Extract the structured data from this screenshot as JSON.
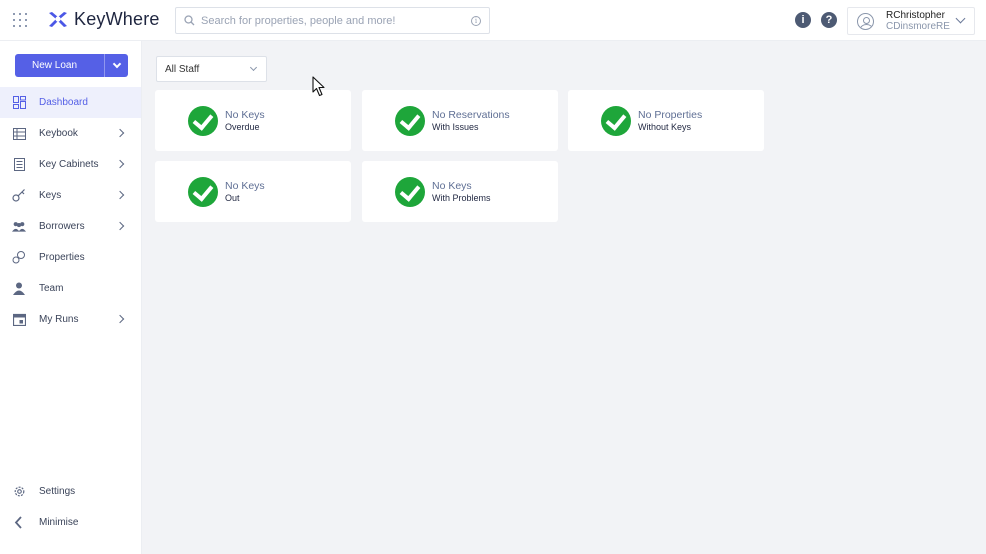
{
  "app": {
    "name": "KeyWhere",
    "brand_color": "#5560e6"
  },
  "header": {
    "search": {
      "placeholder": "Search for properties, people and more!"
    },
    "icons": [
      "apps-grid-icon",
      "info-icon",
      "help-icon"
    ],
    "user": {
      "name": "RChristopher",
      "org": "CDinsmoreRE"
    }
  },
  "sidebar": {
    "new_loan_label": "New Loan",
    "items": [
      {
        "label": "Dashboard",
        "icon": "dashboard-icon",
        "active": true,
        "has_children": false
      },
      {
        "label": "Keybook",
        "icon": "keybook-icon",
        "active": false,
        "has_children": true
      },
      {
        "label": "Key Cabinets",
        "icon": "cabinet-icon",
        "active": false,
        "has_children": true
      },
      {
        "label": "Keys",
        "icon": "key-icon",
        "active": false,
        "has_children": true
      },
      {
        "label": "Borrowers",
        "icon": "people-icon",
        "active": false,
        "has_children": true
      },
      {
        "label": "Properties",
        "icon": "properties-icon",
        "active": false,
        "has_children": false
      },
      {
        "label": "Team",
        "icon": "person-icon",
        "active": false,
        "has_children": false
      },
      {
        "label": "My Runs",
        "icon": "calendar-icon",
        "active": false,
        "has_children": true
      }
    ],
    "bottom": [
      {
        "label": "Settings",
        "icon": "gear-icon"
      },
      {
        "label": "Minimise",
        "icon": "chevron-left-icon"
      }
    ]
  },
  "main": {
    "filter": {
      "selected": "All Staff"
    },
    "cards": [
      {
        "title": "No Keys",
        "subtitle": "Overdue",
        "status_color": "#1ea63a"
      },
      {
        "title": "No Reservations",
        "subtitle": "With Issues",
        "status_color": "#1ea63a"
      },
      {
        "title": "No Properties",
        "subtitle": "Without Keys",
        "status_color": "#1ea63a"
      },
      {
        "title": "No Keys",
        "subtitle": "Out",
        "status_color": "#1ea63a"
      },
      {
        "title": "No Keys",
        "subtitle": "With Problems",
        "status_color": "#1ea63a"
      }
    ]
  }
}
